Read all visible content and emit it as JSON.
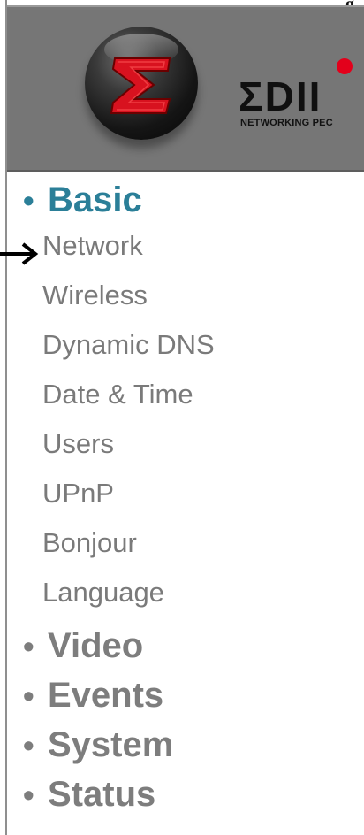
{
  "header_fragment": "g",
  "brand": {
    "wordmark": "ΣDII",
    "tagline": "NETWORKING PEC",
    "accent_color": "#e3001b",
    "logo_icon": "edimax-sigma-sphere-icon"
  },
  "menu": {
    "sections": [
      {
        "label": "Basic",
        "active": true,
        "items": [
          "Network",
          "Wireless",
          "Dynamic DNS",
          "Date & Time",
          "Users",
          "UPnP",
          "Bonjour",
          "Language"
        ]
      },
      {
        "label": "Video",
        "active": false
      },
      {
        "label": "Events",
        "active": false
      },
      {
        "label": "System",
        "active": false
      },
      {
        "label": "Status",
        "active": false
      }
    ],
    "active_color": "#2b7f98",
    "inactive_color": "#7d7d7d",
    "bullet": "•"
  },
  "annotation": {
    "icon": "right-arrow-icon",
    "points_to": "Network"
  }
}
